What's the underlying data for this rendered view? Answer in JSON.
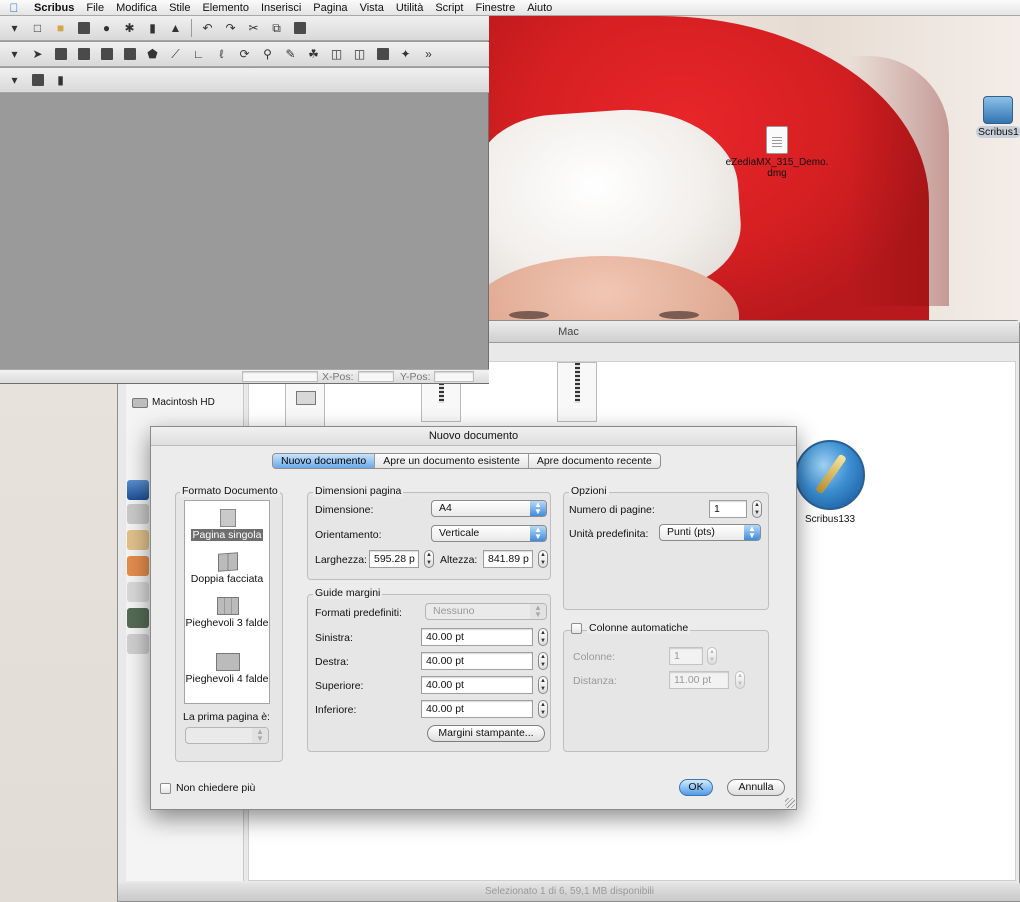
{
  "menubar": {
    "app_name": "Scribus",
    "items": [
      "File",
      "Modifica",
      "Stile",
      "Elemento",
      "Inserisci",
      "Pagina",
      "Vista",
      "Utilità",
      "Script",
      "Finestre",
      "Aiuto"
    ]
  },
  "desktop": {
    "file_icon_label_1": "eZediaMX_315_Demo.",
    "file_icon_label_2": "dmg",
    "drive_icon_label": "Scribus1",
    "app_icon_label": "Scribus133"
  },
  "scribus_window": {
    "status": {
      "xpos_label": "X-Pos:",
      "ypos_label": "Y-Pos:"
    }
  },
  "finder": {
    "title": "Mac",
    "sidebar_item": "Macintosh HD",
    "status": "Selezionato 1 di 6, 59,1 MB disponibili"
  },
  "dialog": {
    "title": "Nuovo documento",
    "tabs": [
      "Nuovo documento",
      "Apre un documento esistente",
      "Apre documento recente"
    ],
    "formato": {
      "title": "Formato Documento",
      "items": [
        "Pagina singola",
        "Doppia facciata",
        "Pieghevoli 3 falde",
        "Pieghevoli 4 falde"
      ],
      "first_page_label": "La prima pagina è:",
      "first_page_value": ""
    },
    "dimensioni": {
      "title": "Dimensioni pagina",
      "size_label": "Dimensione:",
      "size_value": "A4",
      "orient_label": "Orientamento:",
      "orient_value": "Verticale",
      "width_label": "Larghezza:",
      "width_value": "595.28 p",
      "height_label": "Altezza:",
      "height_value": "841.89 p"
    },
    "guide": {
      "title": "Guide margini",
      "preset_label": "Formati predefiniti:",
      "preset_value": "Nessuno",
      "left_label": "Sinistra:",
      "left_value": "40.00 pt",
      "right_label": "Destra:",
      "right_value": "40.00 pt",
      "top_label": "Superiore:",
      "top_value": "40.00 pt",
      "bottom_label": "Inferiore:",
      "bottom_value": "40.00 pt",
      "printer_margins_button": "Margini stampante..."
    },
    "opzioni": {
      "title": "Opzioni",
      "pages_label": "Numero di pagine:",
      "pages_value": "1",
      "unit_label": "Unità predefinita:",
      "unit_value": "Punti (pts)"
    },
    "colonne": {
      "title": "Colonne automatiche",
      "cols_label": "Colonne:",
      "cols_value": "1",
      "gap_label": "Distanza:",
      "gap_value": "11.00 pt"
    },
    "dont_ask_label": "Non chiedere più",
    "ok_button": "OK",
    "cancel_button": "Annulla"
  }
}
